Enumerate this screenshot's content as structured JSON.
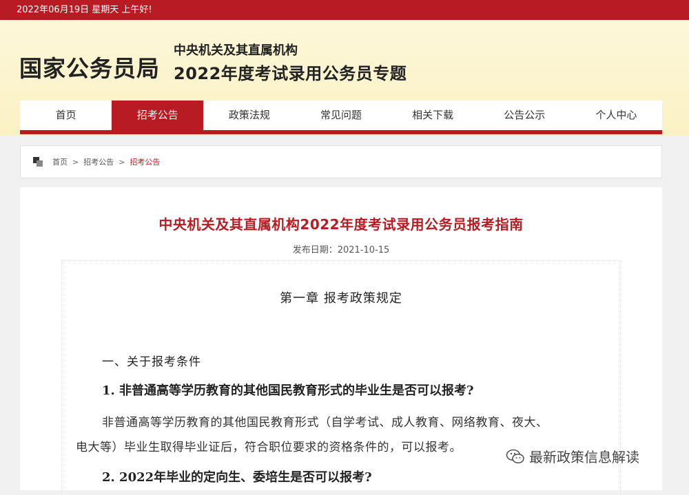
{
  "topbar": {
    "date_text": "2022年06月19日  星期天  上午好!"
  },
  "header": {
    "logo": "国家公务员局",
    "subtitle_line1": "中央机关及其直属机构",
    "subtitle_line2": "2022年度考试录用公务员专题"
  },
  "nav": {
    "items": [
      {
        "label": "首页"
      },
      {
        "label": "招考公告"
      },
      {
        "label": "政策法规"
      },
      {
        "label": "常见问题"
      },
      {
        "label": "相关下载"
      },
      {
        "label": "公告公示"
      },
      {
        "label": "个人中心"
      }
    ],
    "active_index": 1
  },
  "breadcrumb": {
    "items": [
      "首页",
      "招考公告",
      "招考公告"
    ],
    "separator": ">"
  },
  "article": {
    "title": "中央机关及其直属机构2022年度考试录用公务员报考指南",
    "date": "发布日期：2021-10-15",
    "chapter": "第一章  报考政策规定",
    "section": "一、关于报考条件",
    "q1": "1. 非普通高等学历教育的其他国民教育形式的毕业生是否可以报考?",
    "p1_line1": "非普通高等学历教育的其他国民教育形式（自学考试、成人教育、网络教育、夜大、",
    "p1_line2": "电大等）毕业生取得毕业证后，符合职位要求的资格条件的，可以报考。",
    "q2": "2. 2022年毕业的定向生、委培生是否可以报考?"
  },
  "watermark": {
    "text": "最新政策信息解读",
    "icon": "wechat-icon"
  },
  "colors": {
    "brand_red": "#b81c22",
    "header_bg": "#fbf1c4"
  }
}
